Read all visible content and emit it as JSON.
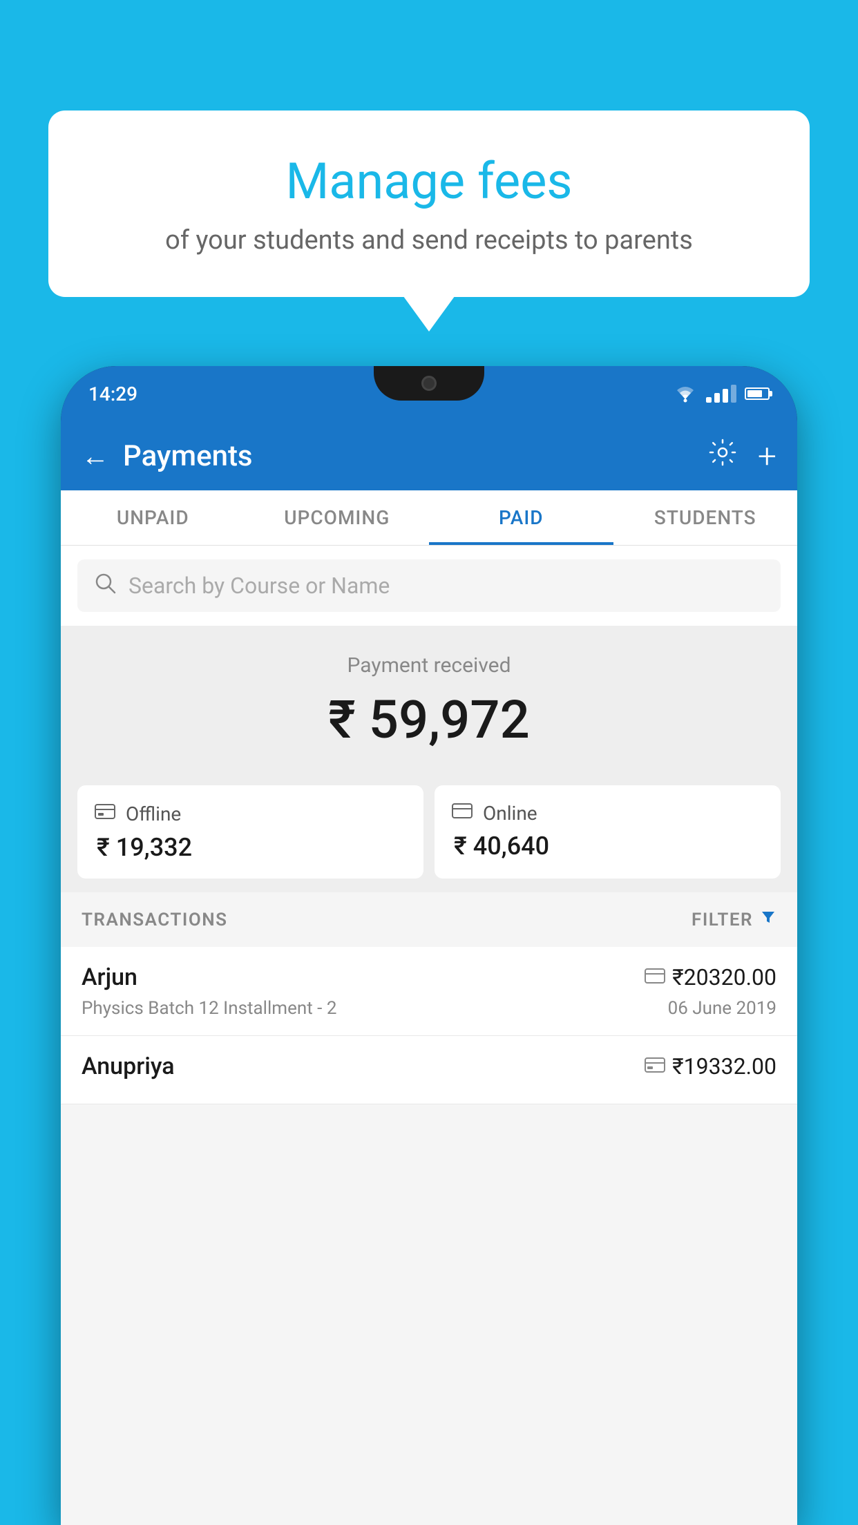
{
  "background_color": "#1ab8e8",
  "speech_bubble": {
    "title": "Manage fees",
    "subtitle": "of your students and send receipts to parents"
  },
  "phone": {
    "status_bar": {
      "time": "14:29"
    },
    "header": {
      "title": "Payments",
      "back_label": "←",
      "settings_label": "⚙",
      "add_label": "+"
    },
    "tabs": [
      {
        "label": "UNPAID",
        "active": false
      },
      {
        "label": "UPCOMING",
        "active": false
      },
      {
        "label": "PAID",
        "active": true
      },
      {
        "label": "STUDENTS",
        "active": false
      }
    ],
    "search": {
      "placeholder": "Search by Course or Name"
    },
    "payment_received": {
      "label": "Payment received",
      "amount": "₹ 59,972",
      "offline": {
        "label": "Offline",
        "amount": "₹ 19,332"
      },
      "online": {
        "label": "Online",
        "amount": "₹ 40,640"
      }
    },
    "transactions_section": {
      "label": "TRANSACTIONS",
      "filter_label": "FILTER"
    },
    "transactions": [
      {
        "name": "Arjun",
        "description": "Physics Batch 12 Installment - 2",
        "amount": "₹20320.00",
        "date": "06 June 2019",
        "type": "online"
      },
      {
        "name": "Anupriya",
        "description": "",
        "amount": "₹19332.00",
        "date": "",
        "type": "offline"
      }
    ]
  }
}
